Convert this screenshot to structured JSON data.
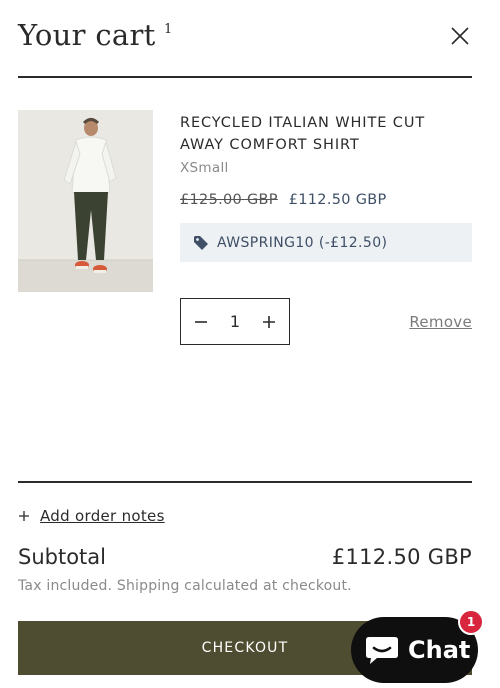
{
  "header": {
    "title": "Your cart",
    "count": "1"
  },
  "item": {
    "title": "RECYCLED ITALIAN WHITE CUT AWAY COMFORT SHIRT",
    "variant": "XSmall",
    "compare_price": "£125.00 GBP",
    "sale_price": "£112.50 GBP",
    "discount": "AWSPRING10 (-£12.50)",
    "quantity": "1",
    "remove_label": "Remove"
  },
  "footer": {
    "order_notes_label": "Add order notes",
    "subtotal_label": "Subtotal",
    "subtotal_value": "£112.50 GBP",
    "tax_note": "Tax included. Shipping calculated at checkout.",
    "checkout_label": "CHECKOUT"
  },
  "chat": {
    "label": "Chat",
    "badge": "1"
  },
  "colors": {
    "checkout_bg": "#4f4d31",
    "discount_bg": "#eef1f4",
    "sale_price": "#3e4f66",
    "chat_bg": "#0f0f0f",
    "badge": "#d7263d"
  },
  "icons": [
    "close-icon",
    "tag-icon",
    "minus-icon",
    "plus-icon",
    "chat-bubble-icon"
  ]
}
